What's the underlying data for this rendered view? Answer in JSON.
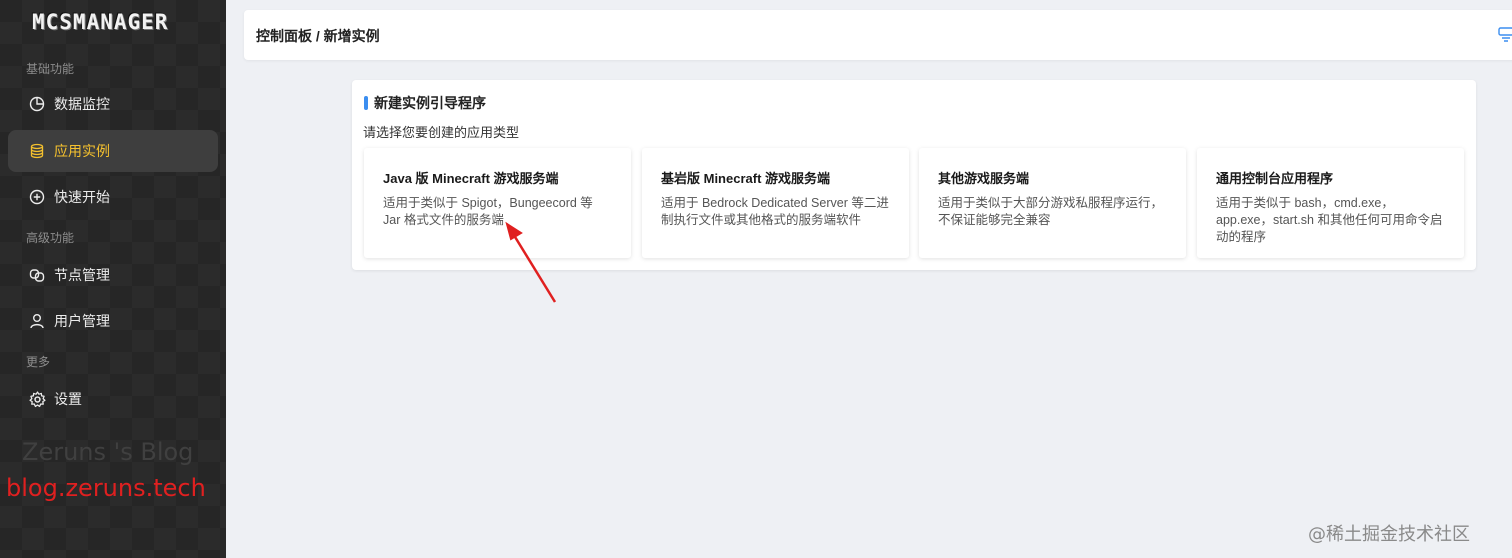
{
  "sidebar": {
    "logo": "MCSMANAGER",
    "sections": [
      {
        "title": "基础功能"
      },
      {
        "title": "高级功能"
      },
      {
        "title": "更多"
      }
    ],
    "items": [
      {
        "label": "数据监控",
        "icon": "pie-chart-icon",
        "active": false
      },
      {
        "label": "应用实例",
        "icon": "database-icon",
        "active": true
      },
      {
        "label": "快速开始",
        "icon": "plus-circle-icon",
        "active": false
      },
      {
        "label": "节点管理",
        "icon": "cluster-icon",
        "active": false
      },
      {
        "label": "用户管理",
        "icon": "user-icon",
        "active": false
      },
      {
        "label": "设置",
        "icon": "gear-icon",
        "active": false
      }
    ],
    "watermark_line1": "Zeruns 's Blog",
    "watermark_line2": "blog.zeruns.tech"
  },
  "header": {
    "breadcrumb": "控制面板 / 新增实例"
  },
  "panel": {
    "title": "新建实例引导程序",
    "subtitle": "请选择您要创建的应用类型",
    "cards": [
      {
        "title": "Java 版 Minecraft 游戏服务端",
        "desc": "适用于类似于 Spigot，Bungeecord 等 Jar 格式文件的服务端"
      },
      {
        "title": "基岩版 Minecraft 游戏服务端",
        "desc": "适用于 Bedrock Dedicated Server 等二进制执行文件或其他格式的服务端软件"
      },
      {
        "title": "其他游戏服务端",
        "desc": "适用于类似于大部分游戏私服程序运行，不保证能够完全兼容"
      },
      {
        "title": "通用控制台应用程序",
        "desc": "适用于类似于 bash，cmd.exe，app.exe，start.sh 和其他任何可用命令启动的程序"
      }
    ]
  },
  "footer_watermark": "@稀土掘金技术社区",
  "colors": {
    "accent": "#3b8ef0",
    "active_nav": "#f5c12e",
    "arrow": "#e02020"
  }
}
